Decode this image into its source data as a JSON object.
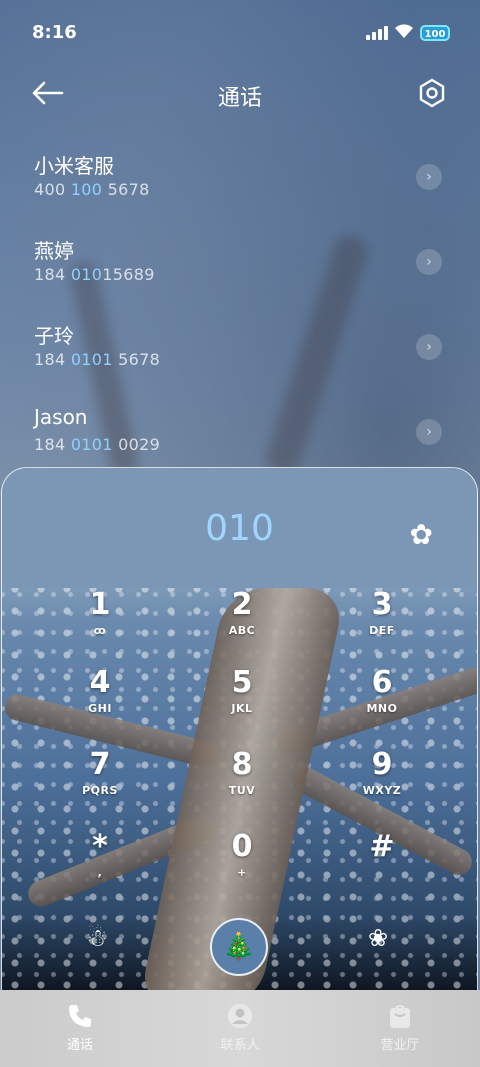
{
  "status_bar": {
    "time": "8:16",
    "battery": "100"
  },
  "header": {
    "title": "通话"
  },
  "contacts": [
    {
      "name": "小米客服",
      "number_pre": "400 ",
      "number_hl": "100",
      "number_post": " 5678"
    },
    {
      "name": "燕婷",
      "number_pre": "184 ",
      "number_hl": "010",
      "number_post": "15689"
    },
    {
      "name": "子玲",
      "number_pre": "184 ",
      "number_hl": "0101",
      "number_post": " 5678"
    },
    {
      "name": "Jason",
      "number_pre": "184 ",
      "number_hl": "0101",
      "number_post": " 0029"
    }
  ],
  "dialer": {
    "input": "010",
    "keys": [
      {
        "digit": "1",
        "letters": "ꝏ"
      },
      {
        "digit": "2",
        "letters": "ABC"
      },
      {
        "digit": "3",
        "letters": "DEF"
      },
      {
        "digit": "4",
        "letters": "GHI"
      },
      {
        "digit": "5",
        "letters": "JKL"
      },
      {
        "digit": "6",
        "letters": "MNO"
      },
      {
        "digit": "7",
        "letters": "PQRS"
      },
      {
        "digit": "8",
        "letters": "TUV"
      },
      {
        "digit": "9",
        "letters": "WXYZ"
      },
      {
        "digit": "*",
        "letters": ","
      },
      {
        "digit": "0",
        "letters": "+"
      },
      {
        "digit": "#",
        "letters": ""
      }
    ],
    "icons": {
      "top_right": "flower-icon",
      "left": "snowman-icon",
      "call": "tree-icon",
      "right": "vase-icon"
    }
  },
  "nav": {
    "tabs": [
      {
        "label": "通话",
        "icon": "phone-icon",
        "active": true
      },
      {
        "label": "联系人",
        "icon": "person-icon",
        "active": false
      },
      {
        "label": "营业厅",
        "icon": "shop-icon",
        "active": false
      }
    ]
  },
  "colors": {
    "accent": "#9fd6ff",
    "battery": "#2a9fd6"
  }
}
